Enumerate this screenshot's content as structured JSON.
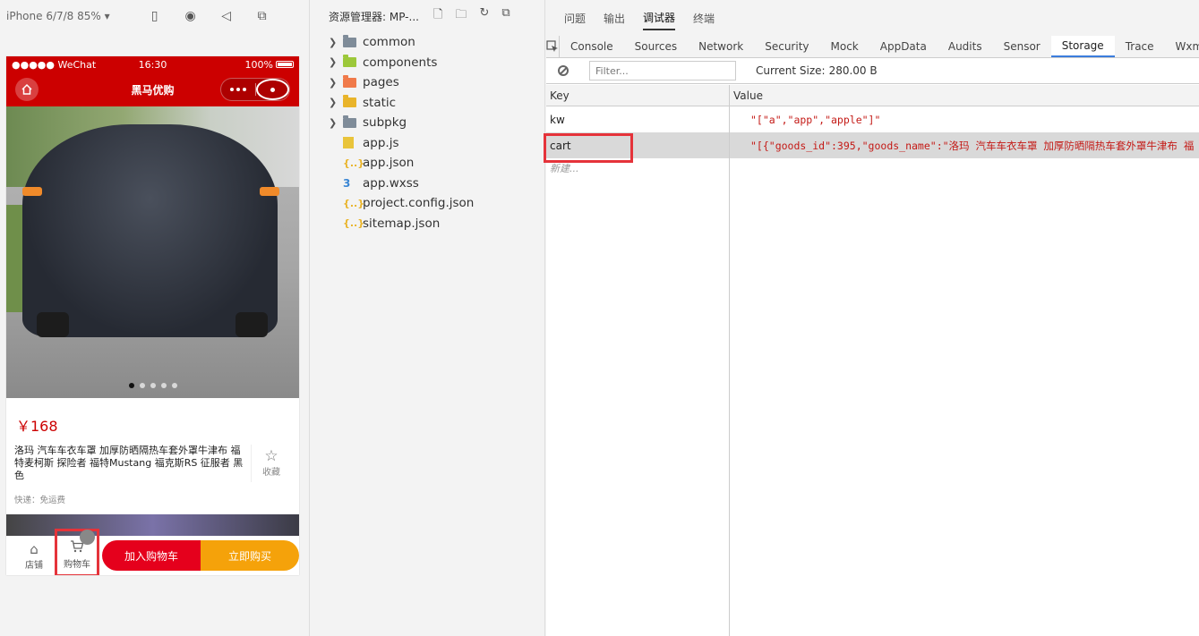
{
  "simulator": {
    "device_label": "iPhone 6/7/8 85% ▾",
    "status_bar": {
      "carrier": "●●●●● WeChat",
      "time": "16:30",
      "battery": "100%"
    },
    "nav_title": "黑马优购",
    "price": "￥168",
    "goods_name": "洛玛 汽车车衣车罩 加厚防晒隔热车套外罩牛津布 福特麦柯斯 探险者 福特Mustang 福克斯RS 征服者 黑色",
    "favorite_label": "收藏",
    "shipping": "快递：免运费",
    "goods_nav": {
      "shop_label": "店铺",
      "cart_label": "购物车",
      "add_cart_button": "加入购物车",
      "buy_now_button": "立即购买"
    },
    "colors": {
      "brand_red": "#cc0000",
      "add_cart": "#e5001c",
      "buy_now": "#f5a20a",
      "highlight": "#e5333a"
    }
  },
  "explorer": {
    "title": "资源管理器: MP-...",
    "items": [
      {
        "label": "common",
        "kind": "folder",
        "color": "#7f8c99"
      },
      {
        "label": "components",
        "kind": "folder",
        "color": "#9cc83a"
      },
      {
        "label": "pages",
        "kind": "folder",
        "color": "#f07a4a"
      },
      {
        "label": "static",
        "kind": "folder",
        "color": "#e9b42a"
      },
      {
        "label": "subpkg",
        "kind": "folder",
        "color": "#7f8c99"
      },
      {
        "label": "app.js",
        "kind": "js"
      },
      {
        "label": "app.json",
        "kind": "json"
      },
      {
        "label": "app.wxss",
        "kind": "css"
      },
      {
        "label": "project.config.json",
        "kind": "json"
      },
      {
        "label": "sitemap.json",
        "kind": "json"
      }
    ]
  },
  "devtools": {
    "top_tabs": [
      "问题",
      "输出",
      "调试器",
      "终端"
    ],
    "active_top_tab": "调试器",
    "tabs": [
      "Console",
      "Sources",
      "Network",
      "Security",
      "Mock",
      "AppData",
      "Audits",
      "Sensor",
      "Storage",
      "Trace",
      "Wxml"
    ],
    "active_tab": "Storage",
    "filter_placeholder": "Filter...",
    "current_size_label": "Current Size:",
    "current_size_value": "280.00 B",
    "table": {
      "headers": {
        "key": "Key",
        "value": "Value"
      },
      "rows": [
        {
          "key": "kw",
          "value": "\"[\"a\",\"app\",\"apple\"]\""
        },
        {
          "key": "cart",
          "value": "\"[{\"goods_id\":395,\"goods_name\":\"洛玛 汽车车衣车罩 加厚防晒隔热车套外罩牛津布 福"
        }
      ],
      "new_row_placeholder": "新建..."
    }
  }
}
